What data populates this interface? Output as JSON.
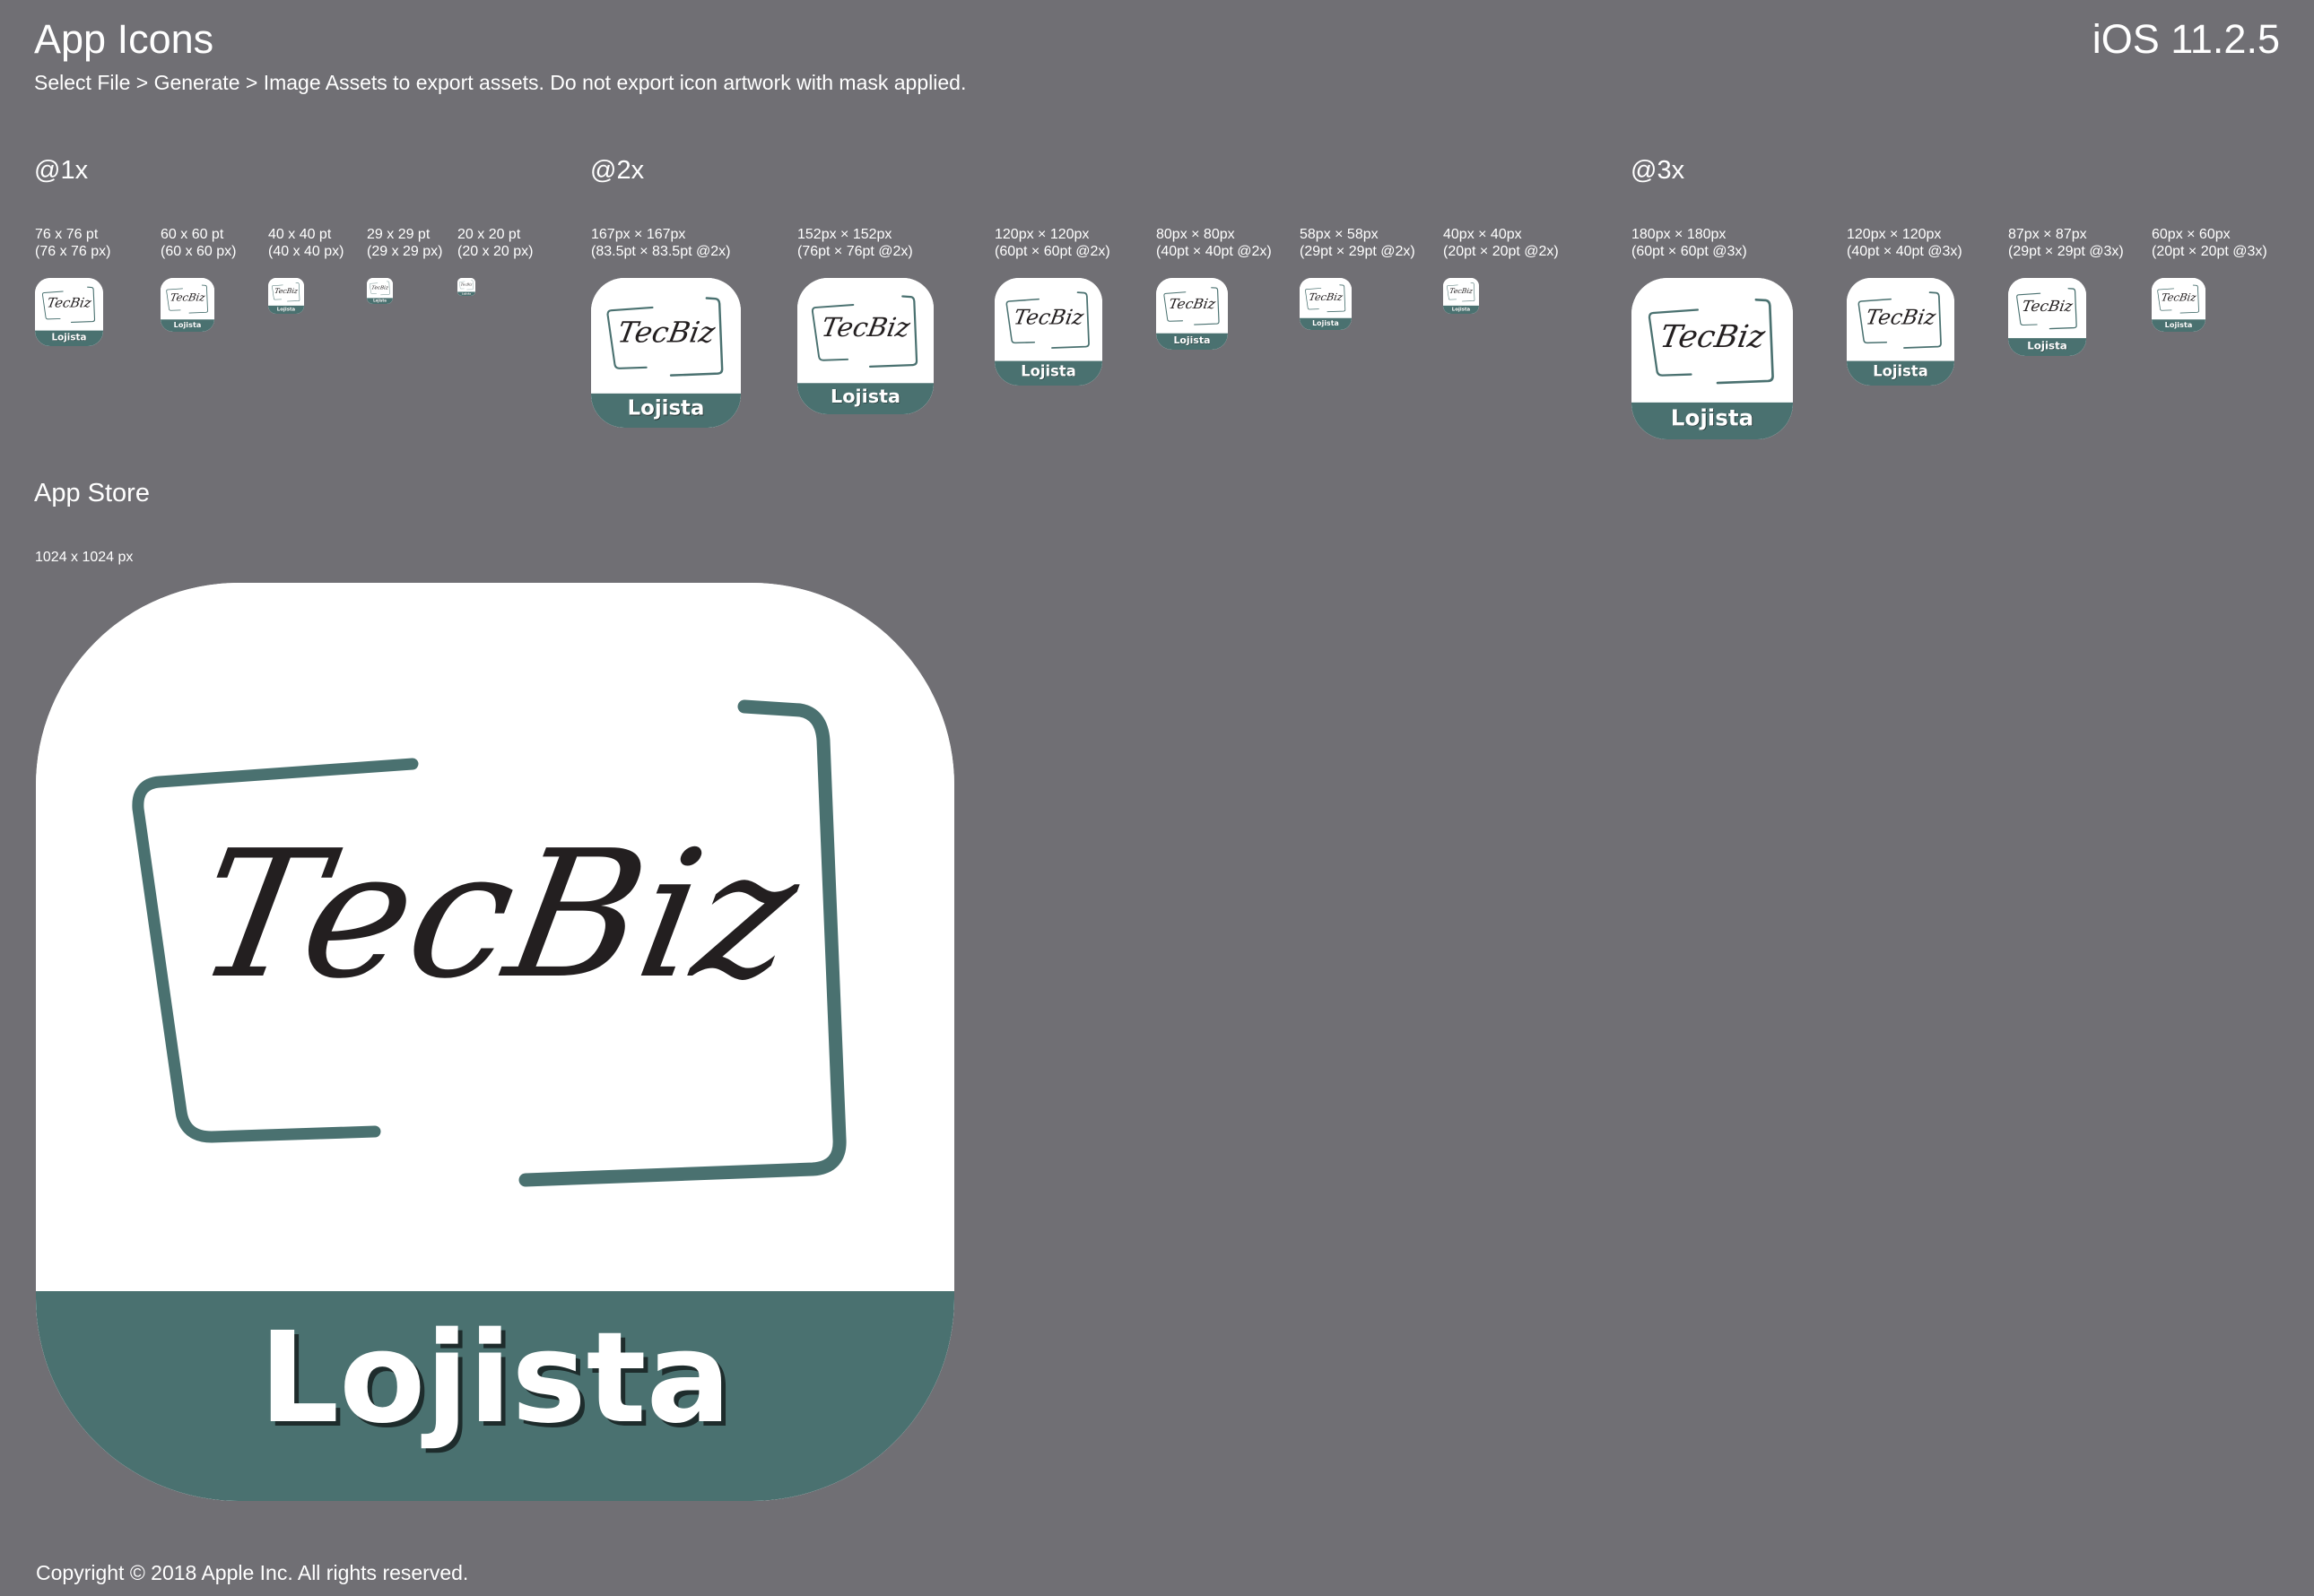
{
  "header": {
    "title": "App Icons",
    "os_version": "iOS 11.2.5",
    "subtitle": "Select File > Generate > Image Assets to export assets. Do not export icon artwork with mask applied."
  },
  "icon_artwork": {
    "brand_text": "TecBiz",
    "band_text": "Lojista",
    "frame_color": "#4a7170",
    "band_color": "#4a7170",
    "background_color": "#ffffff",
    "text_color": "#231f20"
  },
  "sections": {
    "1x": {
      "heading": "@1x",
      "icons": [
        {
          "line1": "76 x 76 pt",
          "line2": "(76 x 76 px)"
        },
        {
          "line1": "60 x 60 pt",
          "line2": "(60 x 60 px)"
        },
        {
          "line1": "40 x 40 pt",
          "line2": "(40 x 40 px)"
        },
        {
          "line1": "29 x 29 pt",
          "line2": "(29 x 29 px)"
        },
        {
          "line1": "20 x 20 pt",
          "line2": "(20 x 20 px)"
        }
      ]
    },
    "2x": {
      "heading": "@2x",
      "icons": [
        {
          "line1": "167px × 167px",
          "line2": "(83.5pt × 83.5pt @2x)"
        },
        {
          "line1": "152px × 152px",
          "line2": "(76pt × 76pt @2x)"
        },
        {
          "line1": "120px × 120px",
          "line2": "(60pt × 60pt @2x)"
        },
        {
          "line1": "80px × 80px",
          "line2": "(40pt × 40pt @2x)"
        },
        {
          "line1": "58px × 58px",
          "line2": "(29pt × 29pt @2x)"
        },
        {
          "line1": "40px × 40px",
          "line2": "(20pt × 20pt @2x)"
        }
      ]
    },
    "3x": {
      "heading": "@3x",
      "icons": [
        {
          "line1": "180px × 180px",
          "line2": "(60pt × 60pt @3x)"
        },
        {
          "line1": "120px × 120px",
          "line2": "(40pt × 40pt @3x)"
        },
        {
          "line1": "87px × 87px",
          "line2": "(29pt × 29pt @3x)"
        },
        {
          "line1": "60px × 60px",
          "line2": "(20pt × 20pt @3x)"
        }
      ]
    },
    "app_store": {
      "heading": "App Store",
      "label": "1024 x 1024 px"
    }
  },
  "footer": {
    "copyright": "Copyright © 2018 Apple Inc. All rights reserved."
  }
}
